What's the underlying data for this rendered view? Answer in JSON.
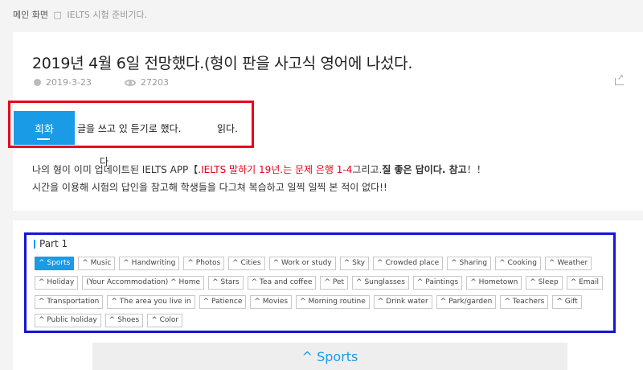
{
  "breadcrumb": {
    "home": "메인 화면",
    "separator": "□",
    "current": "IELTS 시험 준비기다."
  },
  "article": {
    "title": "2019년 4월 6일 전망했다.(형이 판을 사고식 영어에 나섰다.",
    "date": "2019-3-23",
    "views": "27203"
  },
  "tabs": {
    "active": "회화",
    "t2": "글을 쓰고 있 듣기로 했다.",
    "t3": "읽다."
  },
  "stray_char": "다",
  "paragraph": {
    "l1_a": "나의 형이 이미 업데이트된 IELTS APP【.",
    "l1_red": "IELTS 말하기 19년.는 문제 은행 1-4",
    "l1_b": "그리고.",
    "l1_bold": "질 좋은 답이다. 참고",
    "l1_end": "！！",
    "l2": "시간을 이용해 시험의 답인을 참고해 학생들을 다그쳐 복습하고 일찍 일찍 본 적이 없다!!"
  },
  "part": {
    "label": "Part 1",
    "rows": [
      [
        "^ Sports",
        "^ Music",
        "^ Handwriting",
        "^ Photos",
        "^ Cities",
        "^ Work or study",
        "^ Sky",
        "^ Crowded place",
        "^ Sharing",
        "^ Cooking",
        "^ Weather"
      ],
      [
        "^ Holiday",
        "(Your Accommodation) ^ Home",
        "^ Stars",
        "^ Tea and coffee",
        "^ Pet",
        "^ Sunglasses",
        "^ Paintings",
        "^ Hometown",
        "^ Sleep",
        "^ Email"
      ],
      [
        "^ Transportation",
        "^ The area you live in",
        "^ Patience",
        "^ Movies",
        "^ Morning routine",
        "^ Drink water",
        "^ Park/garden",
        "^ Teachers",
        "^ Gift"
      ],
      [
        "^ Public holiday",
        "^ Shoes",
        "^ Color"
      ]
    ],
    "active_topic": "^ Sports"
  },
  "section_heading": "^ Sports",
  "colors": {
    "accent": "#1a9be6",
    "highlight_red": "#e8001c",
    "annotation_red": "#e8001c",
    "annotation_blue": "#1515d6"
  }
}
